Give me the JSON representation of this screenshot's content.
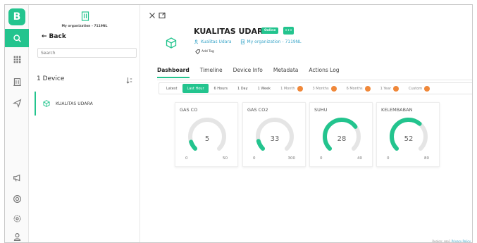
{
  "app": {
    "logo_letter": "B"
  },
  "sidebar": {
    "org_name": "My organization - 7119NL",
    "back_label": "Back",
    "search_placeholder": "Search",
    "device_count": "1 Device",
    "devices": [
      {
        "name": "KUALITAS UDARA"
      }
    ]
  },
  "device": {
    "name": "KUALITAS UDARA",
    "status": "Online",
    "more": "•••",
    "template": "Kualitas Udara",
    "organization": "My organization - 7119NL",
    "add_tag": "Add Tag"
  },
  "tabs": [
    "Dashboard",
    "Timeline",
    "Device Info",
    "Metadata",
    "Actions Log"
  ],
  "active_tab": "Dashboard",
  "time_ranges": [
    {
      "label": "Latest",
      "active": false,
      "pro": false
    },
    {
      "label": "Last Hour",
      "active": true,
      "pro": false
    },
    {
      "label": "6 Hours",
      "active": false,
      "pro": false
    },
    {
      "label": "1 Day",
      "active": false,
      "pro": false
    },
    {
      "label": "1 Week",
      "active": false,
      "pro": false
    },
    {
      "label": "1 Month",
      "active": false,
      "pro": true
    },
    {
      "label": "3 Months",
      "active": false,
      "pro": true
    },
    {
      "label": "6 Months",
      "active": false,
      "pro": true
    },
    {
      "label": "1 Year",
      "active": false,
      "pro": true
    },
    {
      "label": "Custom",
      "active": false,
      "pro": true
    }
  ],
  "gauges": [
    {
      "label": "GAS CO",
      "value": 5,
      "min": 0,
      "max": 50
    },
    {
      "label": "GAS CO2",
      "value": 33,
      "min": 0,
      "max": 300
    },
    {
      "label": "SUHU",
      "value": 28,
      "min": 0,
      "max": 40
    },
    {
      "label": "KELEMBABAN",
      "value": 52,
      "min": 0,
      "max": 80
    }
  ],
  "footer": {
    "text": "Region: sgp1",
    "link": "Privacy Policy"
  },
  "colors": {
    "accent": "#23c48e",
    "pro_badge": "#f0883a",
    "link": "#3aa5c8",
    "track": "#e5e5e5"
  }
}
